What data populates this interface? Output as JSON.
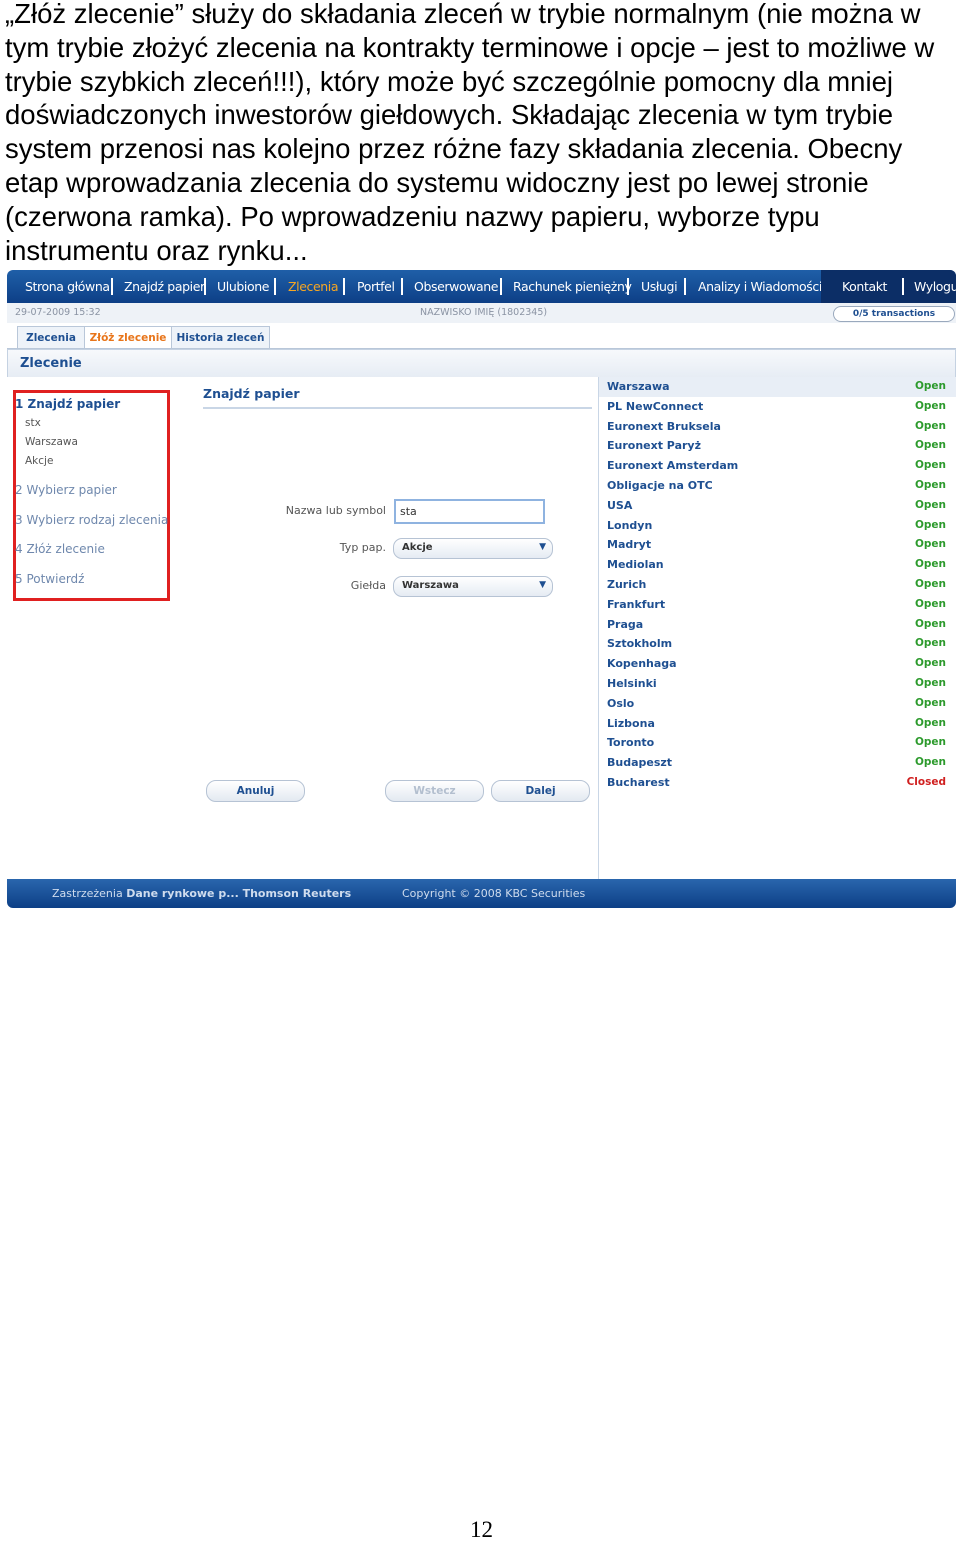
{
  "intro_text": "„Złóż zlecenie” służy do składania zleceń w trybie normalnym (nie można w tym trybie złożyć zlecenia na kontrakty terminowe i opcje – jest to możliwe w trybie szybkich zleceń!!!), który może być szczególnie pomocny dla mniej doświadczonych inwestorów giełdowych. Składając zlecenia w tym trybie system przenosi nas kolejno przez różne fazy składania zlecenia. Obecny etap wprowadzania zlecenia do systemu widoczny jest po lewej stronie (czerwona ramka). Po wprowadzeniu nazwy papieru, wyborze typu instrumentu oraz rynku...",
  "nav": {
    "items": [
      "Strona główna",
      "Znajdź papier",
      "Ulubione",
      "Zlecenia",
      "Portfel",
      "Obserwowane",
      "Rachunek pieniężny",
      "Usługi",
      "Analizy i Wiadomości"
    ],
    "active_index": 3,
    "right": [
      "Kontakt",
      "Wyloguj"
    ]
  },
  "status": {
    "datetime": "29-07-2009 15:32",
    "user": "NAZWISKO IMIĘ (1802345)",
    "transactions": "0/5 transactions"
  },
  "tabs": [
    "Zlecenia",
    "Złóż zlecenie",
    "Historia zleceń"
  ],
  "panel_title": "Zlecenie",
  "steps": {
    "s1": "1 Znajdź papier",
    "s1_details": [
      "stx",
      "Warszawa",
      "Akcje"
    ],
    "s2": "2 Wybierz papier",
    "s3": "3 Wybierz rodzaj zlecenia",
    "s4": "4 Złóż zlecenie",
    "s5": "5 Potwierdź"
  },
  "form": {
    "heading": "Znajdź papier",
    "name_label": "Nazwa lub symbol",
    "name_value": "sta",
    "type_label": "Typ pap.",
    "type_value": "Akcje",
    "exchange_label": "Giełda",
    "exchange_value": "Warszawa",
    "cancel": "Anuluj",
    "back": "Wstecz",
    "next": "Dalej"
  },
  "markets": [
    {
      "name": "Warszawa",
      "status": "Open"
    },
    {
      "name": "PL NewConnect",
      "status": "Open"
    },
    {
      "name": "Euronext Bruksela",
      "status": "Open"
    },
    {
      "name": "Euronext Paryż",
      "status": "Open"
    },
    {
      "name": "Euronext Amsterdam",
      "status": "Open"
    },
    {
      "name": "Obligacje na OTC",
      "status": "Open"
    },
    {
      "name": "USA",
      "status": "Open"
    },
    {
      "name": "Londyn",
      "status": "Open"
    },
    {
      "name": "Madryt",
      "status": "Open"
    },
    {
      "name": "Mediolan",
      "status": "Open"
    },
    {
      "name": "Zurich",
      "status": "Open"
    },
    {
      "name": "Frankfurt",
      "status": "Open"
    },
    {
      "name": "Praga",
      "status": "Open"
    },
    {
      "name": "Sztokholm",
      "status": "Open"
    },
    {
      "name": "Kopenhaga",
      "status": "Open"
    },
    {
      "name": "Helsinki",
      "status": "Open"
    },
    {
      "name": "Oslo",
      "status": "Open"
    },
    {
      "name": "Lizbona",
      "status": "Open"
    },
    {
      "name": "Toronto",
      "status": "Open"
    },
    {
      "name": "Budapeszt",
      "status": "Open"
    },
    {
      "name": "Bucharest",
      "status": "Closed"
    }
  ],
  "footer": {
    "disclaimer_prefix": "Zastrzeżenia",
    "disclaimer_bold": "Dane rynkowe p... Thomson Reuters",
    "copyright": "Copyright © 2008 KBC Securities"
  },
  "page_number": "12",
  "colors": {
    "nav_blue": "#0d3f86",
    "active_orange": "#f6a623",
    "highlight_red": "#e02020",
    "open_green": "#2c9a2c",
    "closed_red": "#d01f1f"
  }
}
